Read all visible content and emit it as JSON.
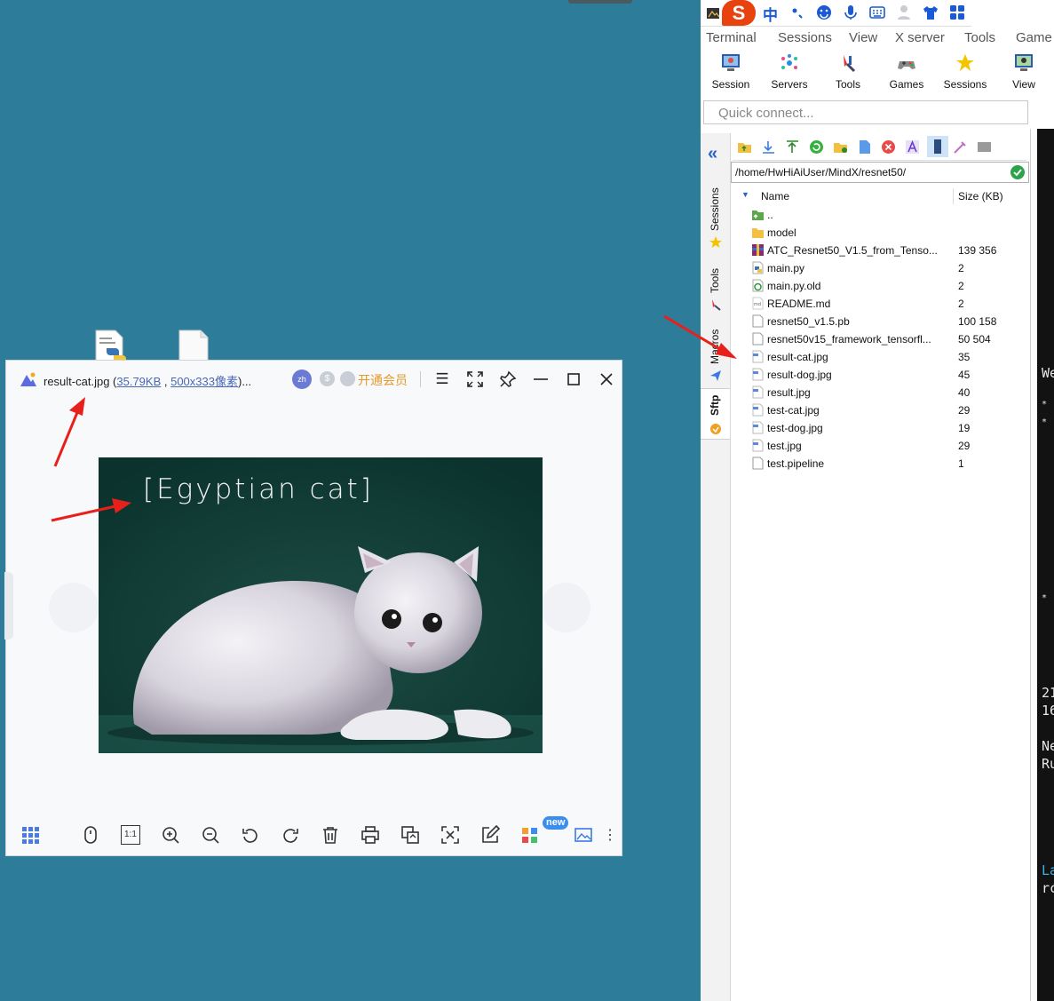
{
  "viewer": {
    "filename": "result-cat.jpg",
    "paren_open": " (",
    "file_size": "35.79KB",
    "comma": " , ",
    "dimensions": "500x333像素",
    "paren_close": ")...",
    "lang_badge": "zh",
    "vip_label": "开通会员",
    "image_caption": "[Egyptian  cat]",
    "ratio_label": "1:1",
    "new_badge": "new"
  },
  "ime": {
    "logo": "S",
    "mode": "中"
  },
  "moba": {
    "menu": [
      "Terminal",
      "Sessions",
      "View",
      "X server",
      "Tools",
      "Game"
    ],
    "ribbon": [
      "Session",
      "Servers",
      "Tools",
      "Games",
      "Sessions",
      "View"
    ],
    "quick_connect_placeholder": "Quick connect...",
    "side_tabs": {
      "sessions": "Sessions",
      "tools": "Tools",
      "macros": "Macros",
      "sftp": "Sftp"
    },
    "path": "/home/HwHiAiUser/MindX/resnet50/",
    "columns": {
      "name": "Name",
      "size": "Size (KB)"
    },
    "files": [
      {
        "name": "..",
        "size": "",
        "icon": "parent-folder-icon"
      },
      {
        "name": "model",
        "size": "",
        "icon": "folder-icon"
      },
      {
        "name": "ATC_Resnet50_V1.5_from_Tenso...",
        "size": "139 356",
        "icon": "archive-icon"
      },
      {
        "name": "main.py",
        "size": "2",
        "icon": "python-file-icon"
      },
      {
        "name": "main.py.old",
        "size": "2",
        "icon": "recycle-file-icon"
      },
      {
        "name": "README.md",
        "size": "2",
        "icon": "markdown-file-icon"
      },
      {
        "name": "resnet50_v1.5.pb",
        "size": "100 158",
        "icon": "file-icon"
      },
      {
        "name": "resnet50v15_framework_tensorfl...",
        "size": "50 504",
        "icon": "file-icon"
      },
      {
        "name": "result-cat.jpg",
        "size": "35",
        "icon": "image-file-icon"
      },
      {
        "name": "result-dog.jpg",
        "size": "45",
        "icon": "image-file-icon"
      },
      {
        "name": "result.jpg",
        "size": "40",
        "icon": "image-file-icon"
      },
      {
        "name": "test-cat.jpg",
        "size": "29",
        "icon": "image-file-icon"
      },
      {
        "name": "test-dog.jpg",
        "size": "19",
        "icon": "image-file-icon"
      },
      {
        "name": "test.jpg",
        "size": "29",
        "icon": "image-file-icon"
      },
      {
        "name": "test.pipeline",
        "size": "1",
        "icon": "file-icon"
      }
    ]
  },
  "terminal": {
    "lines": [
      {
        "text": "We",
        "color": "#e8e8e8"
      },
      {
        "text": "*",
        "color": "#e8e8e8"
      },
      {
        "text": "*",
        "color": "#e8e8e8"
      },
      {
        "text": "*",
        "color": "#e8e8e8"
      },
      {
        "text": "21",
        "color": "#e8e8e8"
      },
      {
        "text": "16",
        "color": "#e8e8e8"
      },
      {
        "text": "Ne",
        "color": "#e8e8e8"
      },
      {
        "text": "Ru",
        "color": "#e8e8e8"
      },
      {
        "text": "La",
        "color": "#3ab0e8"
      },
      {
        "text": "rc",
        "color": "#e8e8e8"
      }
    ]
  }
}
